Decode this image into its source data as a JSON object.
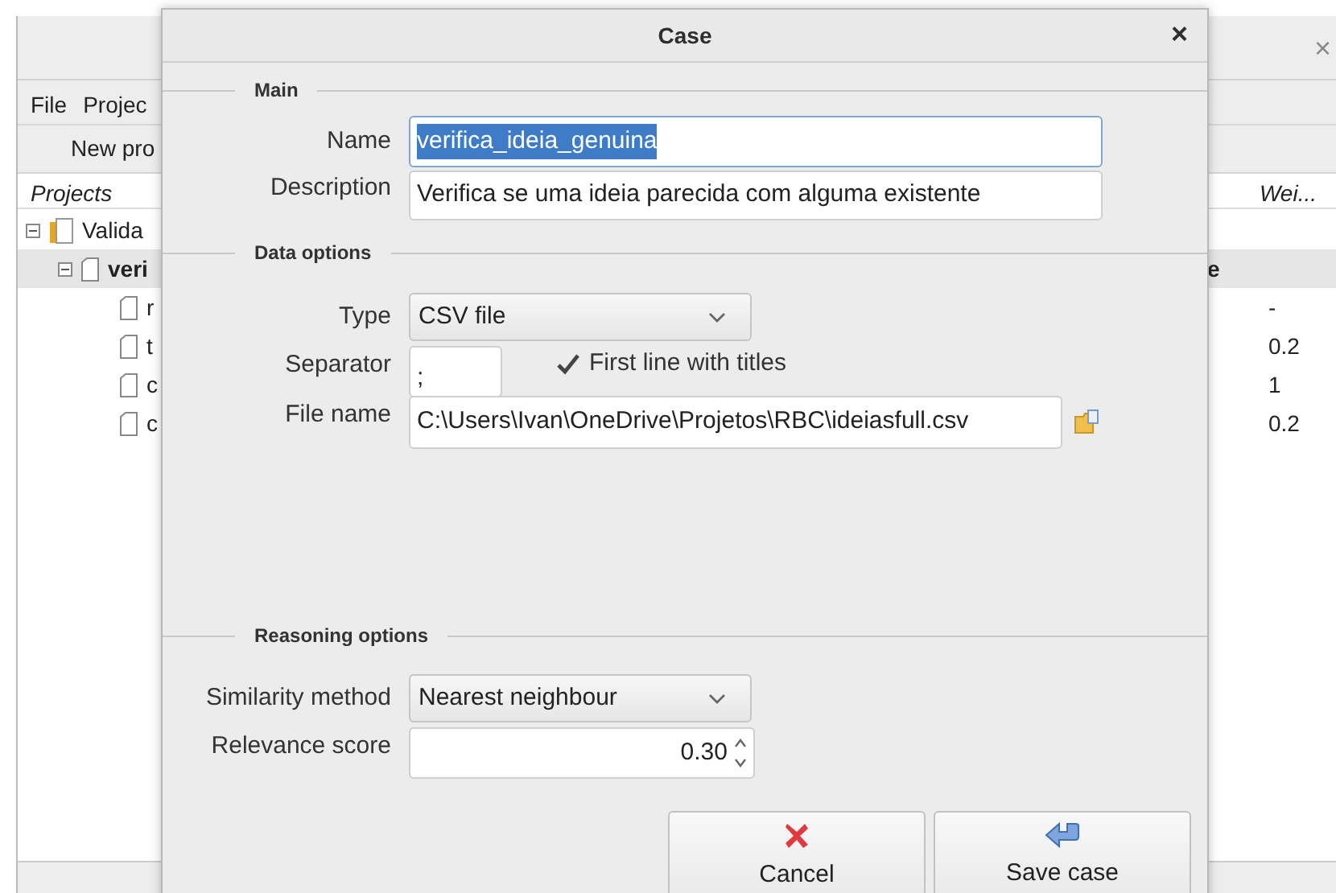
{
  "background_window": {
    "close_glyph": "×",
    "menu": [
      "File",
      "Projec"
    ],
    "toolbar": [
      "New pro"
    ],
    "tree_header": "Projects",
    "column_header": "Wei...",
    "tree": [
      {
        "label": "Valida",
        "kind": "folder",
        "expanded": true,
        "selected": false,
        "children": [
          {
            "label": "veri",
            "kind": "document",
            "expanded": true,
            "selected": true,
            "value": "e",
            "children": [
              {
                "label": "r",
                "kind": "document",
                "selected": false,
                "value": "-"
              },
              {
                "label": "t",
                "kind": "document",
                "selected": false,
                "value": "0.2"
              },
              {
                "label": "c",
                "kind": "document",
                "selected": false,
                "value": "1"
              },
              {
                "label": "c",
                "kind": "document",
                "selected": false,
                "value": "0.2"
              }
            ]
          }
        ]
      }
    ]
  },
  "dialog": {
    "title": "Case",
    "close_glyph": "×",
    "main": {
      "title": "Main",
      "name": {
        "label": "Name",
        "value": "verifica_ideia_genuina",
        "selected": true
      },
      "description": {
        "label": "Description",
        "value": "Verifica se uma ideia parecida com alguma existente"
      }
    },
    "data_options": {
      "title": "Data options",
      "type": {
        "label": "Type",
        "value": "CSV file"
      },
      "separator": {
        "label": "Separator",
        "value": ";"
      },
      "first_line_titles": {
        "label": "First line with titles",
        "checked": true
      },
      "file_name": {
        "label": "File name",
        "value": "C:\\Users\\Ivan\\OneDrive\\Projetos\\RBC\\ideiasfull.csv"
      }
    },
    "reasoning_options": {
      "title": "Reasoning options",
      "similarity_method": {
        "label": "Similarity method",
        "value": "Nearest neighbour"
      },
      "relevance_score": {
        "label": "Relevance score",
        "value": "0.30"
      }
    },
    "buttons": [
      {
        "label": "Cancel",
        "kind": "cancel"
      },
      {
        "label": "Save case",
        "kind": "save"
      }
    ]
  }
}
